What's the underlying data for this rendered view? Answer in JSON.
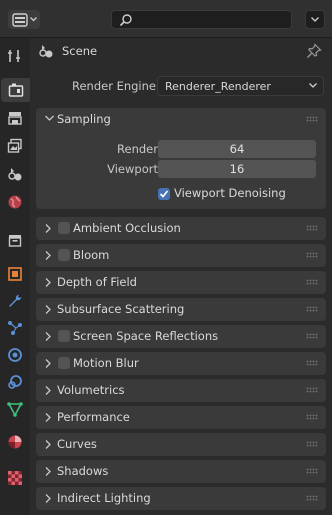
{
  "header": {
    "editor_type_icon": "properties-editor-icon",
    "search_icon": "search-icon",
    "options_icon": "chevron-down-icon"
  },
  "sidebar": {
    "tabs": [
      {
        "name": "tool",
        "icon": "tool-icon"
      },
      {
        "name": "render",
        "icon": "render-icon",
        "active": true
      },
      {
        "name": "output",
        "icon": "output-icon"
      },
      {
        "name": "view-layer",
        "icon": "view-layer-icon"
      },
      {
        "name": "scene",
        "icon": "scene-icon"
      },
      {
        "name": "world",
        "icon": "world-icon"
      },
      {
        "name": "collection",
        "icon": "collection-icon"
      },
      {
        "name": "object",
        "icon": "object-icon"
      },
      {
        "name": "modifiers",
        "icon": "wrench-icon"
      },
      {
        "name": "particles",
        "icon": "particles-icon"
      },
      {
        "name": "physics",
        "icon": "physics-icon"
      },
      {
        "name": "constraints",
        "icon": "constraints-icon"
      },
      {
        "name": "data",
        "icon": "mesh-data-icon"
      },
      {
        "name": "material",
        "icon": "material-icon"
      },
      {
        "name": "texture",
        "icon": "texture-icon"
      }
    ]
  },
  "context": {
    "label": "Scene"
  },
  "render_engine": {
    "label": "Render Engine",
    "value": "Renderer_Renderer"
  },
  "sampling": {
    "title": "Sampling",
    "render_label": "Render",
    "render_value": "64",
    "viewport_label": "Viewport",
    "viewport_value": "16",
    "denoise_label": "Viewport Denoising",
    "denoise_checked": true
  },
  "panels": [
    {
      "title": "Ambient Occlusion",
      "checkbox": true
    },
    {
      "title": "Bloom",
      "checkbox": true
    },
    {
      "title": "Depth of Field",
      "checkbox": false
    },
    {
      "title": "Subsurface Scattering",
      "checkbox": false
    },
    {
      "title": "Screen Space Reflections",
      "checkbox": true
    },
    {
      "title": "Motion Blur",
      "checkbox": true
    },
    {
      "title": "Volumetrics",
      "checkbox": false
    },
    {
      "title": "Performance",
      "checkbox": false
    },
    {
      "title": "Curves",
      "checkbox": false
    },
    {
      "title": "Shadows",
      "checkbox": false
    },
    {
      "title": "Indirect Lighting",
      "checkbox": false
    }
  ],
  "colors": {
    "accent": "#4772b3",
    "panel": "#3a3a3a",
    "background": "#2b2b2b"
  }
}
